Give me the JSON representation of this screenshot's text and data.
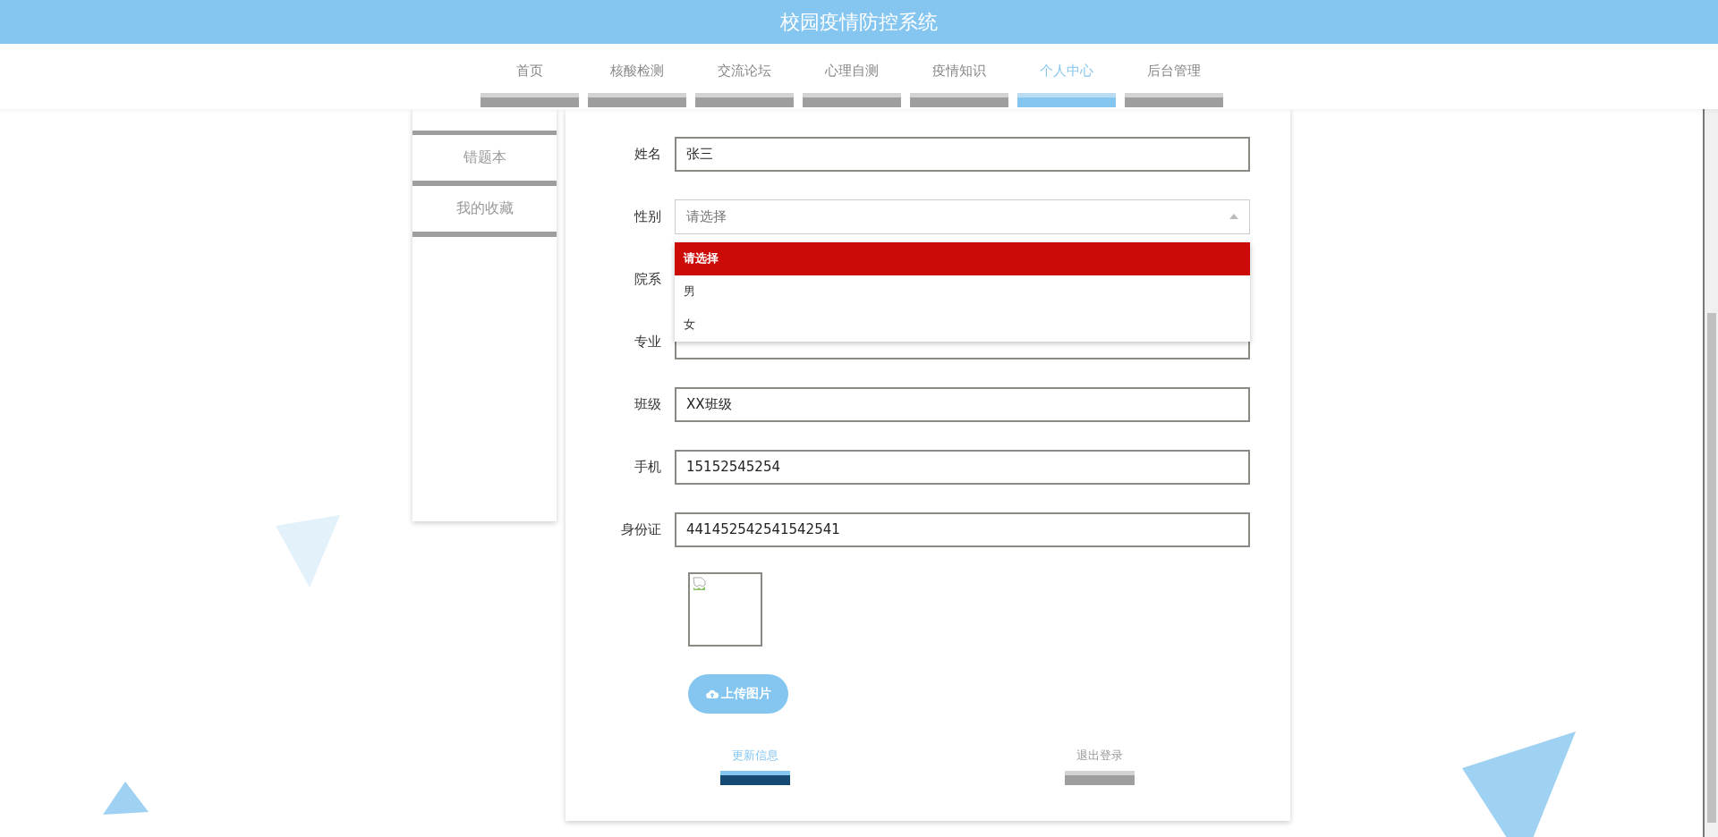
{
  "header": {
    "title": "校园疫情防控系统"
  },
  "nav": [
    {
      "label": "首页",
      "selected": false
    },
    {
      "label": "核酸检测",
      "selected": false
    },
    {
      "label": "交流论坛",
      "selected": false
    },
    {
      "label": "心理自测",
      "selected": false
    },
    {
      "label": "疫情知识",
      "selected": false
    },
    {
      "label": "个人中心",
      "selected": true
    },
    {
      "label": "后台管理",
      "selected": false
    }
  ],
  "sidebar": {
    "items": [
      {
        "label": "错题本"
      },
      {
        "label": "我的收藏"
      }
    ]
  },
  "form": {
    "fields": [
      {
        "kind": "text",
        "label": "姓名",
        "value": "张三"
      },
      {
        "kind": "select",
        "label": "性别",
        "placeholder": "请选择",
        "expanded": true,
        "options": [
          {
            "label": "请选择",
            "selected": true
          },
          {
            "label": "男",
            "selected": false
          },
          {
            "label": "女",
            "selected": false
          }
        ]
      },
      {
        "kind": "text",
        "label": "院系"
      },
      {
        "kind": "text",
        "label": "专业"
      },
      {
        "kind": "text",
        "label": "班级",
        "value": "XX班级"
      },
      {
        "kind": "text",
        "label": "手机",
        "value": "15152545254"
      },
      {
        "kind": "text",
        "label": "身份证",
        "value": "441452542541542541"
      }
    ],
    "upload_button": "上传图片",
    "actions": [
      {
        "label": "更新信息",
        "selected": true
      },
      {
        "label": "退出登录",
        "selected": false
      }
    ]
  }
}
